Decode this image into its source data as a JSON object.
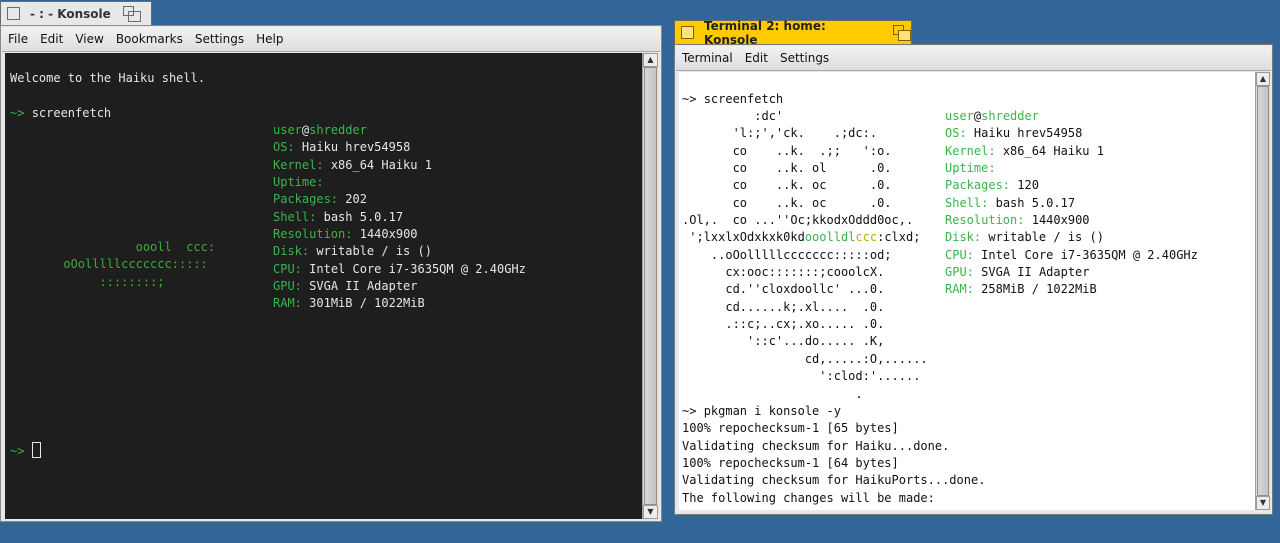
{
  "window1": {
    "title": "- : - Konsole",
    "menu": [
      "File",
      "Edit",
      "View",
      "Bookmarks",
      "Settings",
      "Help"
    ],
    "welcome": "Welcome to the Haiku shell.",
    "prompt": "~>",
    "command": "screenfetch",
    "logo": [
      "                oooll  ccc:",
      "      oOolllllccccccc:::::",
      "           ::::::::;"
    ],
    "info": {
      "user": "user",
      "at": "@",
      "host": "shredder",
      "os_label": "OS:",
      "os": "Haiku hrev54958",
      "kernel_label": "Kernel:",
      "kernel": "x86_64 Haiku 1",
      "uptime_label": "Uptime:",
      "uptime": "",
      "packages_label": "Packages:",
      "packages": "202",
      "shell_label": "Shell:",
      "shell": "bash 5.0.17",
      "resolution_label": "Resolution:",
      "resolution": "1440x900",
      "disk_label": "Disk:",
      "disk": "writable / is ()",
      "cpu_label": "CPU:",
      "cpu": "Intel Core i7-3635QM @ 2.40GHz",
      "gpu_label": "GPU:",
      "gpu": "SVGA II Adapter",
      "ram_label": "RAM:",
      "ram": "301MiB / 1022MiB"
    }
  },
  "window2": {
    "title": "Terminal 2: home: Konsole",
    "menu": [
      "Terminal",
      "Edit",
      "Settings"
    ],
    "prompt": "~>",
    "command": "screenfetch",
    "logo": [
      "          :dc'",
      "       'l:;','ck.    .;dc:.",
      "       co    ..k.  .;;   ':o.",
      "       co    ..k. ol      .0.",
      "       co    ..k. oc      .0.",
      "       co    ..k. oc      .0.",
      ".Ol,.  co ...''Oc;kkodxOddd0oc,.",
      " ';lxxlxOdxkxk0kd",
      "    ..oOolllllccccccc:::::od;",
      "      cx:ooc:::::::;cooolcX.",
      "      cd.''cloxdoollc' ...0.",
      "      cd......k;.xl....  .0.",
      "      .::c;..cx;.xo..... .0.",
      "         '::c'...do..... .K,",
      "                 cd,.....:O,......",
      "                   ':clod:'......",
      "                        ."
    ],
    "logo_line7_green": "ooolldl",
    "logo_line7_yellow": "ccc",
    "logo_line7_end": ":clxd;",
    "info": {
      "user": "user",
      "at": "@",
      "host": "shredder",
      "os_label": "OS:",
      "os": "Haiku hrev54958",
      "kernel_label": "Kernel:",
      "kernel": "x86_64 Haiku 1",
      "uptime_label": "Uptime:",
      "uptime": "",
      "packages_label": "Packages:",
      "packages": "120",
      "shell_label": "Shell:",
      "shell": "bash 5.0.17",
      "resolution_label": "Resolution:",
      "resolution": "1440x900",
      "disk_label": "Disk:",
      "disk": "writable / is ()",
      "cpu_label": "CPU:",
      "cpu": "Intel Core i7-3635QM @ 2.40GHz",
      "gpu_label": "GPU:",
      "gpu": "SVGA II Adapter",
      "ram_label": "RAM:",
      "ram": "258MiB / 1022MiB"
    },
    "command2": "pkgman i konsole -y",
    "output": [
      "100% repochecksum-1 [65 bytes]",
      "Validating checksum for Haiku...done.",
      "100% repochecksum-1 [64 bytes]",
      "Validating checksum for HaikuPorts...done.",
      "The following changes will be made:"
    ]
  },
  "colors": {
    "desktop": "#336698",
    "active_tab": "#ffcb00",
    "inactive_tab": "#e8e8e8",
    "prompt_green": "#39b54a"
  }
}
